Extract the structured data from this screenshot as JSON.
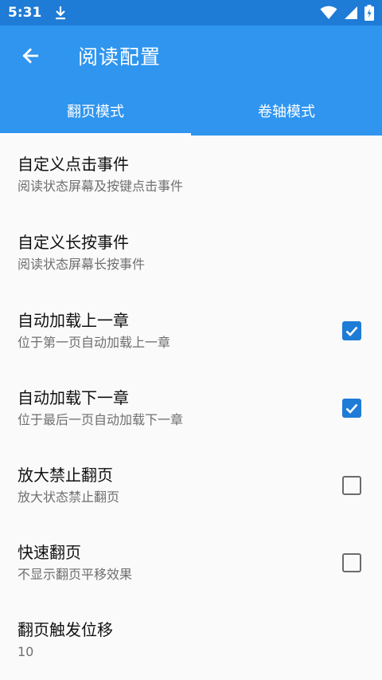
{
  "status_bar": {
    "time": "5:31",
    "icons": [
      "download-icon",
      "wifi-icon",
      "signal-icon",
      "battery-icon"
    ]
  },
  "appbar": {
    "title": "阅读配置",
    "back_icon": "arrow-left-icon"
  },
  "tabs": [
    {
      "label": "翻页模式",
      "active": true
    },
    {
      "label": "卷轴模式",
      "active": false
    }
  ],
  "settings": [
    {
      "title": "自定义点击事件",
      "subtitle": "阅读状态屏幕及按键点击事件"
    },
    {
      "title": "自定义长按事件",
      "subtitle": "阅读状态屏幕长按事件"
    },
    {
      "title": "自动加载上一章",
      "subtitle": "位于第一页自动加载上一章",
      "checked": true
    },
    {
      "title": "自动加载下一章",
      "subtitle": "位于最后一页自动加载下一章",
      "checked": true
    },
    {
      "title": "放大禁止翻页",
      "subtitle": "放大状态禁止翻页",
      "checked": false
    },
    {
      "title": "快速翻页",
      "subtitle": "不显示翻页平移效果",
      "checked": false
    },
    {
      "title": "翻页触发位移",
      "subtitle": "10"
    }
  ],
  "colors": {
    "status_bar": "#1e7bd6",
    "primary": "#2f95ef",
    "checkbox_on": "#1e7bd6"
  }
}
